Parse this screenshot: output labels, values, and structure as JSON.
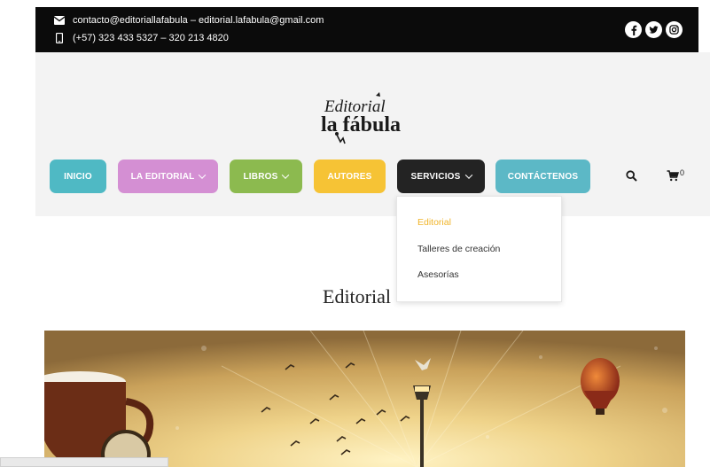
{
  "topbar": {
    "email": "contacto@editoriallafabula – editorial.lafabula@gmail.com",
    "phone": "(+57) 323 433 5327 – 320 213 4820",
    "social": [
      "facebook-icon",
      "twitter-icon",
      "instagram-icon"
    ]
  },
  "logo": {
    "line1": "Editorial",
    "line2": "la fábula"
  },
  "nav": {
    "items": [
      {
        "label": "INICIO",
        "color": "#4fb9c4"
      },
      {
        "label": "LA EDITORIAL",
        "color": "#d48fd3"
      },
      {
        "label": "LIBROS",
        "color": "#8cba4f"
      },
      {
        "label": "AUTORES",
        "color": "#f6c335"
      },
      {
        "label": "SERVICIOS",
        "color": "#232323"
      },
      {
        "label": "CONTÁCTENOS",
        "color": "#5cb8c6"
      }
    ],
    "cart_count": "0"
  },
  "dropdown": {
    "items": [
      {
        "label": "Editorial",
        "active": true,
        "color": "#f0b429"
      },
      {
        "label": "Talleres de creación",
        "active": false
      },
      {
        "label": "Asesorías",
        "active": false
      }
    ]
  },
  "page": {
    "title": "Editorial"
  }
}
